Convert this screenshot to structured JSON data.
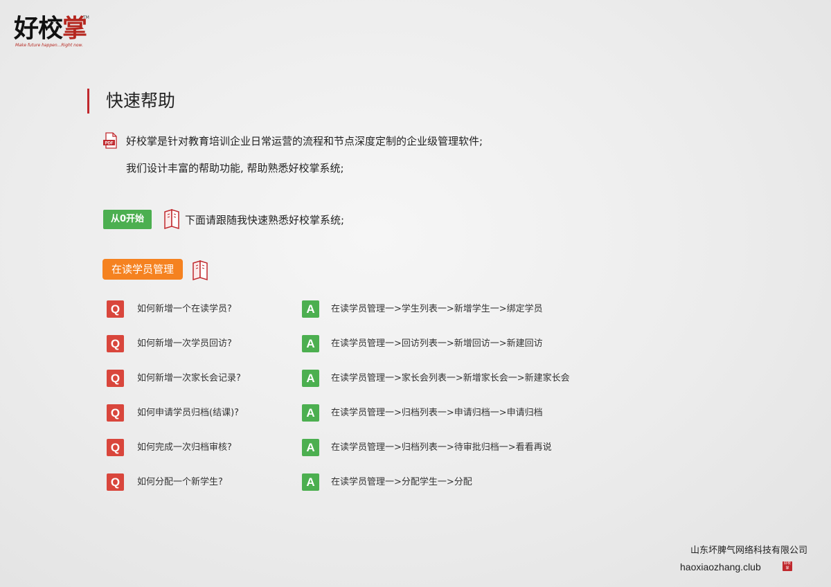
{
  "logo": {
    "brand_black": "好校",
    "brand_red": "掌",
    "tm": "TM",
    "slogan": "Make future happen...Right now."
  },
  "heading": {
    "title": "快速帮助"
  },
  "intro": {
    "icon": "pdf-icon",
    "icon_label": "PDF",
    "line1": "好校掌是针对教育培训企业日常运营的流程和节点深度定制的企业级管理软件;",
    "line2": "我们设计丰富的帮助功能,  帮助熟悉好校掌系统;"
  },
  "start": {
    "badge": "从0开始",
    "text": "下面请跟随我快速熟悉好校掌系统;"
  },
  "section": {
    "badge": "在读学员管理"
  },
  "qa": {
    "q_label": "Q",
    "a_label": "A",
    "items": [
      {
        "q": "如何新增一个在读学员?",
        "a": "在读学员管理一>学生列表一>新增学生一>绑定学员"
      },
      {
        "q": "如何新增一次学员回访?",
        "a": "在读学员管理一>回访列表一>新增回访一>新建回访"
      },
      {
        "q": "如何新增一次家长会记录?",
        "a": "在读学员管理一>家长会列表一>新增家长会一>新建家长会"
      },
      {
        "q": "如何申请学员归档(结课)?",
        "a": "在读学员管理一>归档列表一>申请归档一>申请归档"
      },
      {
        "q": "如何完成一次归档审核?",
        "a": "在读学员管理一>归档列表一>待审批归档一>看看再说"
      },
      {
        "q": "如何分配一个新学生?",
        "a": "在读学员管理一>分配学生一>分配"
      }
    ]
  },
  "footer": {
    "company": "山东坏脾气网络科技有限公司",
    "website": "haoxiaozhang.club",
    "mini_logo": "好校掌"
  },
  "colors": {
    "accent_red": "#c0282d",
    "q_red": "#d9463c",
    "green": "#4caf50",
    "orange": "#f58220"
  }
}
